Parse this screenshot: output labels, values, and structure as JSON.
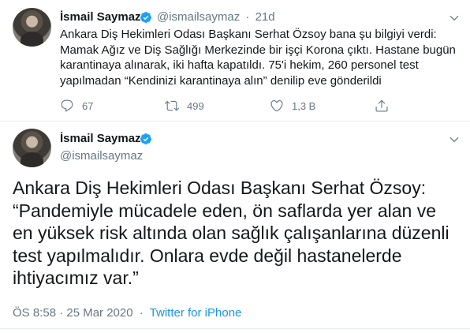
{
  "tweet1": {
    "author_name": "İsmail Saymaz",
    "author_handle": "@ismailsaymaz",
    "separator": "·",
    "time": "21d",
    "text": "Ankara Diş Hekimleri Odası Başkanı Serhat Özsoy bana şu bilgiyi verdi: Mamak Ağız ve Diş Sağlığı Merkezinde bir işçi Korona çıktı. Hastane bugün karantinaya alınarak, iki hafta kapatıldı. 75'i hekim, 260 personel test yapılmadan “Kendinizi karantinaya alın” denilip eve gönderildi",
    "reply_count": "67",
    "retweet_count": "499",
    "like_count": "1,3 B"
  },
  "tweet2": {
    "author_name": "İsmail Saymaz",
    "author_handle": "@ismailsaymaz",
    "text": "Ankara Diş Hekimleri Odası Başkanı Serhat Özsoy: “Pandemiyle mücadele eden, ön saflarda yer alan ve en yüksek risk altında olan sağlık çalışanlarına düzenli test yapılmalıdır. Onlara evde değil hastanelerde ihtiyacımız var.”",
    "timestamp": "ÖS 8:58 · 25 Mar 2020",
    "meta_separator": "·",
    "source": "Twitter for iPhone"
  },
  "icons": {
    "verified": "verified-badge-icon",
    "more": "chevron-down-icon",
    "reply": "reply-icon",
    "retweet": "retweet-icon",
    "like": "heart-icon",
    "share": "share-icon"
  },
  "colors": {
    "text": "#14171a",
    "secondary": "#657786",
    "link": "#1b95e0",
    "verified": "#1da1f2",
    "divider": "#e6ecf0"
  }
}
